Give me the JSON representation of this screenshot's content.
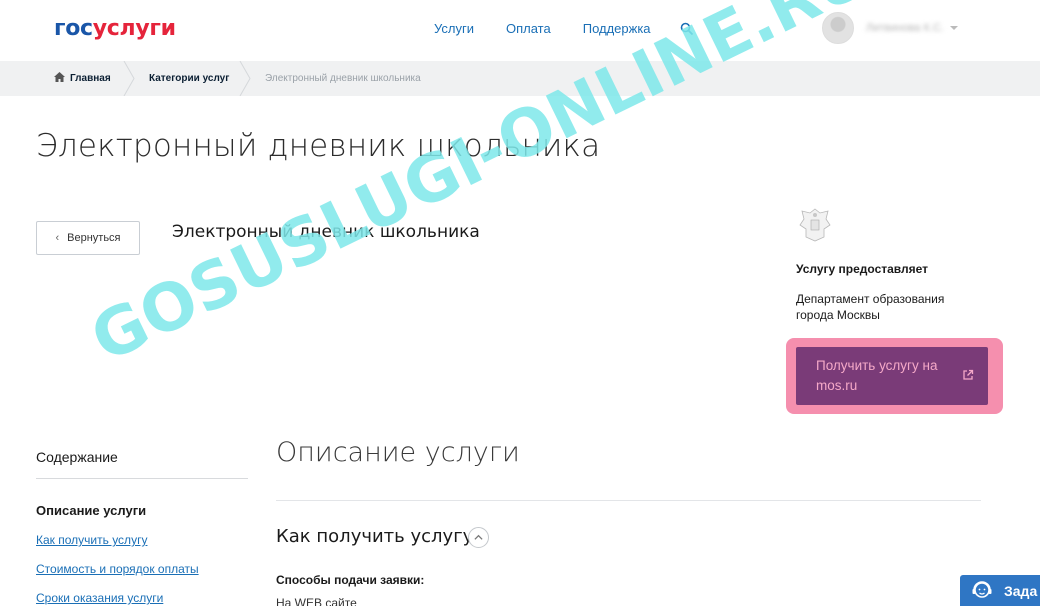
{
  "header": {
    "logo_part1": "гос",
    "logo_part2": "услуги",
    "nav": [
      "Услуги",
      "Оплата",
      "Поддержка"
    ],
    "user_name": "Литвинова К.С."
  },
  "breadcrumb": [
    "Главная",
    "Категории услуг",
    "Электронный дневник школьника"
  ],
  "page_title": "Электронный дневник школьника",
  "back_label": "Вернуться",
  "service_heading": "Электронный дневник школьника",
  "provider": {
    "label": "Услугу предоставляет",
    "name": "Департамент образования города Москвы",
    "button_label": "Получить услугу на mos.ru"
  },
  "toc": {
    "title": "Содержание",
    "active": "Описание услуги",
    "links": [
      "Как получить услугу",
      "Стоимость и порядок оплаты",
      "Сроки оказания услуги"
    ]
  },
  "main": {
    "desc_title": "Описание услуги",
    "how_title": "Как получить услугу",
    "methods_label": "Способы подачи заявки:",
    "methods_value": "На WEB сайте"
  },
  "chat_label": "Зада",
  "watermark": "GOSUSLUGI-ONLINE.RU",
  "colors": {
    "accent": "#1a6fb6",
    "button_bg": "#7a3b78",
    "highlight": "#f58fae",
    "watermark": "#7ee8ea"
  }
}
